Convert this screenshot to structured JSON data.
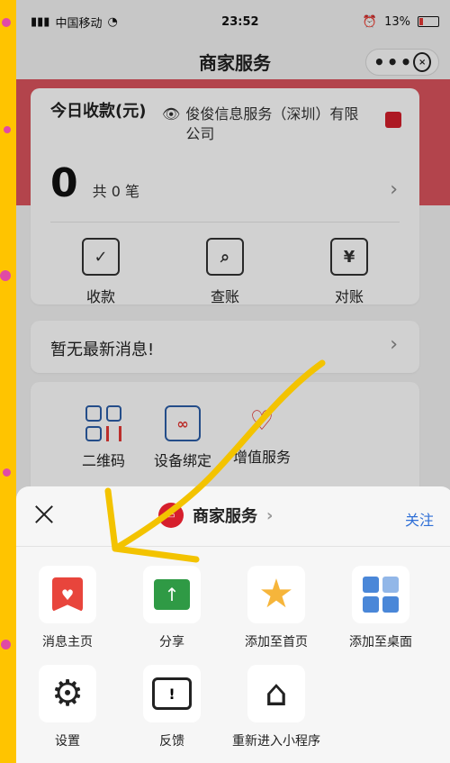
{
  "status_bar": {
    "carrier": "中国移动",
    "time": "23:52",
    "battery": "13%"
  },
  "nav": {
    "title": "商家服务"
  },
  "summary": {
    "title": "今日收款(元)",
    "company": "俊俊信息服务（深圳）有限公司",
    "amount": "0",
    "count_label": "共 0 笔",
    "actions": [
      {
        "label": "收款",
        "icon": "scan-receive-icon"
      },
      {
        "label": "查账",
        "icon": "search-bill-icon"
      },
      {
        "label": "对账",
        "icon": "reconcile-icon"
      }
    ]
  },
  "message": {
    "text": "暂无最新消息!"
  },
  "services": [
    {
      "label": "二维码",
      "icon": "qr-code-icon"
    },
    {
      "label": "设备绑定",
      "icon": "device-bind-icon"
    },
    {
      "label": "增值服务",
      "icon": "value-added-icon"
    }
  ],
  "sheet": {
    "mini_app_name": "商家服务",
    "follow_label": "关注",
    "items_row1": [
      {
        "label": "消息主页",
        "icon": "message-home-icon"
      },
      {
        "label": "分享",
        "icon": "share-icon"
      },
      {
        "label": "添加至首页",
        "icon": "star-icon"
      },
      {
        "label": "添加至桌面",
        "icon": "add-to-desktop-icon"
      }
    ],
    "items_row2": [
      {
        "label": "设置",
        "icon": "settings-icon"
      },
      {
        "label": "反馈",
        "icon": "feedback-icon"
      },
      {
        "label": "重新进入小程序",
        "icon": "home-reenter-icon"
      }
    ]
  },
  "colors": {
    "brand_red": "#d31f2b",
    "link_blue": "#2f6fd6",
    "frame_yellow": "#ffc400"
  }
}
